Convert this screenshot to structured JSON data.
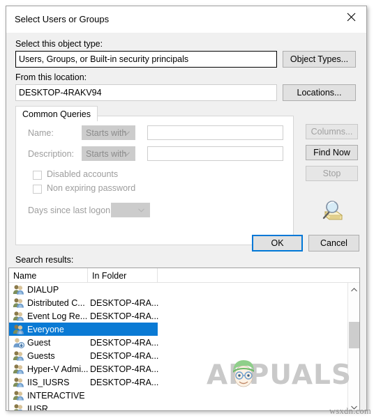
{
  "window": {
    "title": "Select Users or Groups",
    "close_icon": "close-icon"
  },
  "object_type": {
    "label": "Select this object type:",
    "value": "Users, Groups, or Built-in security principals",
    "button": "Object Types..."
  },
  "location": {
    "label": "From this location:",
    "value": "DESKTOP-4RAKV94",
    "button": "Locations..."
  },
  "tabs": [
    {
      "label": "Common Queries",
      "selected": true
    }
  ],
  "query": {
    "name_label": "Name:",
    "name_operator": "Starts with",
    "name_value": "",
    "description_label": "Description:",
    "description_operator": "Starts with",
    "description_value": "",
    "disabled_accounts_label": "Disabled accounts",
    "disabled_accounts_checked": false,
    "non_expiring_password_label": "Non expiring password",
    "non_expiring_password_checked": false,
    "days_label": "Days since last logon:",
    "days_value": ""
  },
  "side_buttons": {
    "columns": "Columns...",
    "find_now": "Find Now",
    "stop": "Stop",
    "search_icon": "magnifier-folder-icon"
  },
  "dialog_buttons": {
    "ok": "OK",
    "cancel": "Cancel"
  },
  "results": {
    "label": "Search results:",
    "columns": [
      "Name",
      "In Folder"
    ],
    "rows": [
      {
        "name": "DIALUP",
        "folder": "",
        "icon": "group-icon",
        "selected": false
      },
      {
        "name": "Distributed C...",
        "folder": "DESKTOP-4RA...",
        "icon": "group-icon",
        "selected": false
      },
      {
        "name": "Event Log Re...",
        "folder": "DESKTOP-4RA...",
        "icon": "group-icon",
        "selected": false
      },
      {
        "name": "Everyone",
        "folder": "",
        "icon": "group-icon",
        "selected": true
      },
      {
        "name": "Guest",
        "folder": "DESKTOP-4RA...",
        "icon": "user-icon",
        "selected": false
      },
      {
        "name": "Guests",
        "folder": "DESKTOP-4RA...",
        "icon": "group-icon",
        "selected": false
      },
      {
        "name": "Hyper-V Admi...",
        "folder": "DESKTOP-4RA...",
        "icon": "group-icon",
        "selected": false
      },
      {
        "name": "IIS_IUSRS",
        "folder": "DESKTOP-4RA...",
        "icon": "group-icon",
        "selected": false
      },
      {
        "name": "INTERACTIVE",
        "folder": "",
        "icon": "group-icon",
        "selected": false
      },
      {
        "name": "IUSR",
        "folder": "",
        "icon": "group-icon",
        "selected": false
      }
    ]
  },
  "watermark": {
    "brand": "APPUALS",
    "site": "wsxdn.com"
  },
  "colors": {
    "selection": "#0a7ad4",
    "default_button_focus": "#0078d7",
    "dialog_background": "#f0f0f0",
    "field_background": "#ffffff",
    "disabled_text": "#9d9d9d"
  }
}
